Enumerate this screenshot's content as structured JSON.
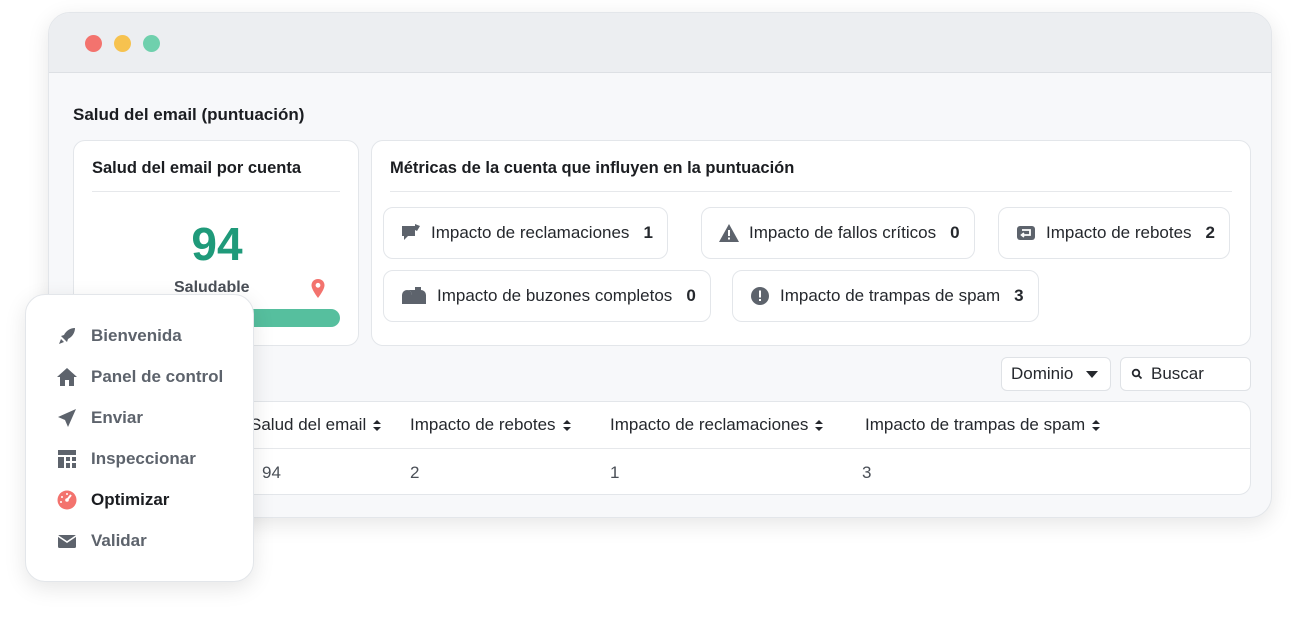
{
  "page_title": "Salud del email (puntuación)",
  "account_card": {
    "title": "Salud del email por cuenta",
    "score": "94",
    "status": "Saludable",
    "bar_colors": [
      "#f3736e",
      "#f6c24f",
      "#56bf9e"
    ]
  },
  "metrics_card": {
    "title": "Métricas de la cuenta que influyen en la puntuación",
    "metrics": [
      {
        "label": "Impacto de reclamaciones",
        "value": "1",
        "icon": "complaint-icon"
      },
      {
        "label": "Impacto de fallos críticos",
        "value": "0",
        "icon": "warning-icon"
      },
      {
        "label": "Impacto de rebotes",
        "value": "2",
        "icon": "bounce-icon"
      },
      {
        "label": "Impacto de buzones completos",
        "value": "0",
        "icon": "mailbox-icon"
      },
      {
        "label": "Impacto de trampas de spam",
        "value": "3",
        "icon": "alert-icon"
      }
    ]
  },
  "filters": {
    "select_value": "Dominio",
    "search_placeholder": "Buscar"
  },
  "table": {
    "columns": [
      "Salud del email",
      "Impacto de rebotes",
      "Impacto de reclamaciones",
      "Impacto de trampas de spam"
    ],
    "rows": [
      [
        "94",
        "2",
        "1",
        "3"
      ]
    ]
  },
  "sidebar": {
    "items": [
      {
        "label": "Bienvenida",
        "icon": "rocket-icon"
      },
      {
        "label": "Panel de control",
        "icon": "home-icon"
      },
      {
        "label": "Enviar",
        "icon": "send-icon"
      },
      {
        "label": "Inspeccionar",
        "icon": "grid-icon"
      },
      {
        "label": "Optimizar",
        "icon": "gauge-icon",
        "active": true
      },
      {
        "label": "Validar",
        "icon": "envelope-icon"
      }
    ]
  },
  "colors": {
    "score": "#1f9a7a",
    "accent_red": "#f3736e",
    "accent_yellow": "#f6c24f",
    "accent_green": "#6fd0ad"
  }
}
